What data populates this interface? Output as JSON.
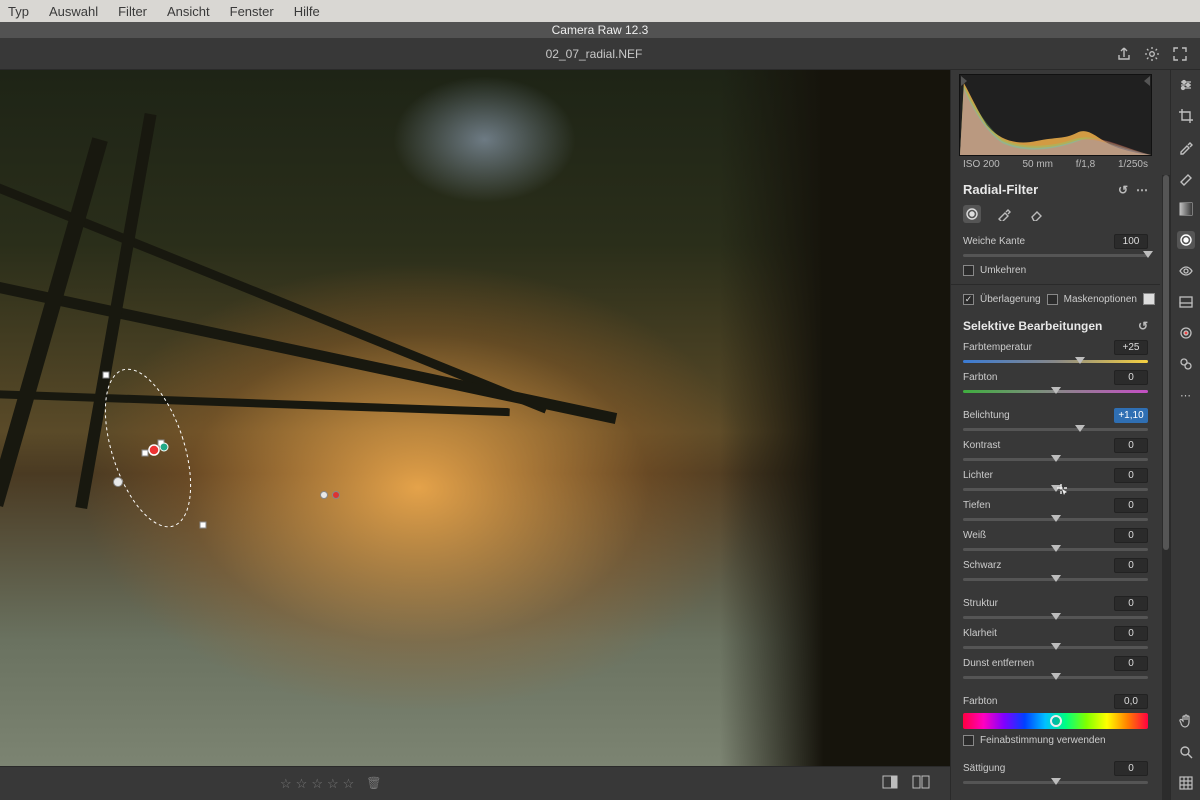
{
  "os_menu": [
    "Typ",
    "Auswahl",
    "Filter",
    "Ansicht",
    "Fenster",
    "Hilfe"
  ],
  "app_title": "Camera Raw 12.3",
  "filename": "02_07_radial.NEF",
  "exif": {
    "iso": "ISO 200",
    "focal": "50 mm",
    "aperture": "f/1,8",
    "shutter": "1/250s"
  },
  "panel": {
    "title": "Radial-Filter",
    "feather_label": "Weiche Kante",
    "feather_value": "100",
    "invert_label": "Umkehren",
    "overlay_label": "Überlagerung",
    "maskopts_label": "Maskenoptionen"
  },
  "selective": {
    "title": "Selektive Bearbeitungen",
    "sliders": [
      {
        "key": "temp",
        "label": "Farbtemperatur",
        "value": "+25",
        "pos": 63,
        "track": "temp"
      },
      {
        "key": "tint",
        "label": "Farbton",
        "value": "0",
        "pos": 50,
        "track": "tint"
      },
      {
        "key": "exposure",
        "label": "Belichtung",
        "value": "+1,10",
        "pos": 63,
        "selected": true
      },
      {
        "key": "contrast",
        "label": "Kontrast",
        "value": "0",
        "pos": 50
      },
      {
        "key": "highlights",
        "label": "Lichter",
        "value": "0",
        "pos": 50
      },
      {
        "key": "shadows",
        "label": "Tiefen",
        "value": "0",
        "pos": 50
      },
      {
        "key": "whites",
        "label": "Weiß",
        "value": "0",
        "pos": 50
      },
      {
        "key": "blacks",
        "label": "Schwarz",
        "value": "0",
        "pos": 50
      },
      {
        "key": "texture",
        "label": "Struktur",
        "value": "0",
        "pos": 50
      },
      {
        "key": "clarity",
        "label": "Klarheit",
        "value": "0",
        "pos": 50
      },
      {
        "key": "dehaze",
        "label": "Dunst entfernen",
        "value": "0",
        "pos": 50
      },
      {
        "key": "hue",
        "label": "Farbton",
        "value": "0,0",
        "pos": 50,
        "huestrip": true
      },
      {
        "key": "saturation",
        "label": "Sättigung",
        "value": "0",
        "pos": 50
      }
    ],
    "finetune_label": "Feinabstimmung verwenden"
  },
  "groups": [
    [
      "temp",
      "tint"
    ],
    [
      "exposure",
      "contrast",
      "highlights",
      "shadows",
      "whites",
      "blacks"
    ],
    [
      "texture",
      "clarity",
      "dehaze"
    ],
    [
      "hue"
    ],
    [
      "saturation"
    ]
  ],
  "toolstrip": [
    "edit",
    "crop",
    "eyedropper",
    "brush",
    "gradient",
    "radial",
    "eye",
    "spot",
    "redeye",
    "preset",
    "more"
  ],
  "toolstrip_active": "radial"
}
